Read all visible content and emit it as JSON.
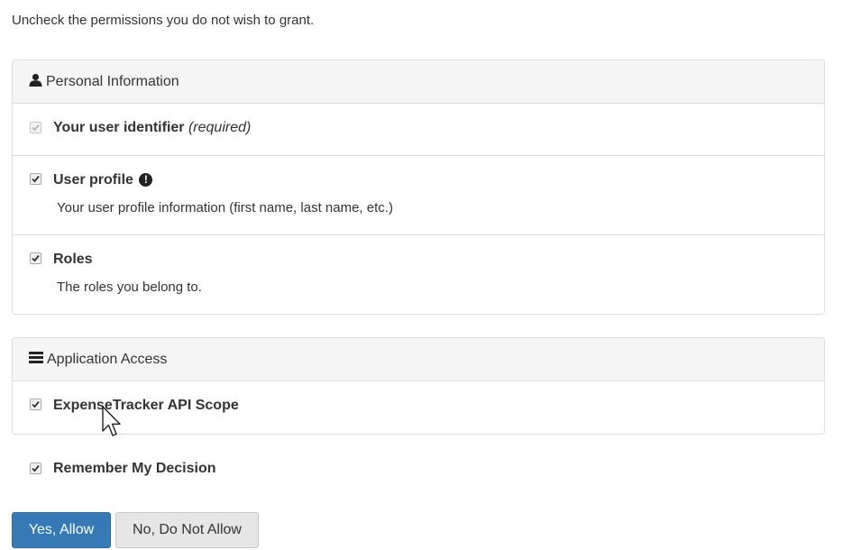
{
  "intro": "Uncheck the permissions you do not wish to grant.",
  "personal": {
    "heading": "Personal Information",
    "icon": "user-icon",
    "items": [
      {
        "label": "Your user identifier",
        "note": "(required)",
        "checked": true,
        "disabled": true
      },
      {
        "label": "User profile",
        "description": "Your user profile information (first name, last name, etc.)",
        "checked": true,
        "badge": "!"
      },
      {
        "label": "Roles",
        "description": "The roles you belong to.",
        "checked": true
      }
    ]
  },
  "application": {
    "heading": "Application Access",
    "icon": "list-icon",
    "items": [
      {
        "label": "ExpenseTracker API Scope",
        "checked": true
      }
    ]
  },
  "remember": {
    "label": "Remember My Decision",
    "checked": true
  },
  "buttons": {
    "allow": "Yes, Allow",
    "deny": "No, Do Not Allow"
  },
  "colors": {
    "primary": "#337ab7",
    "panel_heading_bg": "#f5f5f5",
    "border": "#dddddd"
  }
}
